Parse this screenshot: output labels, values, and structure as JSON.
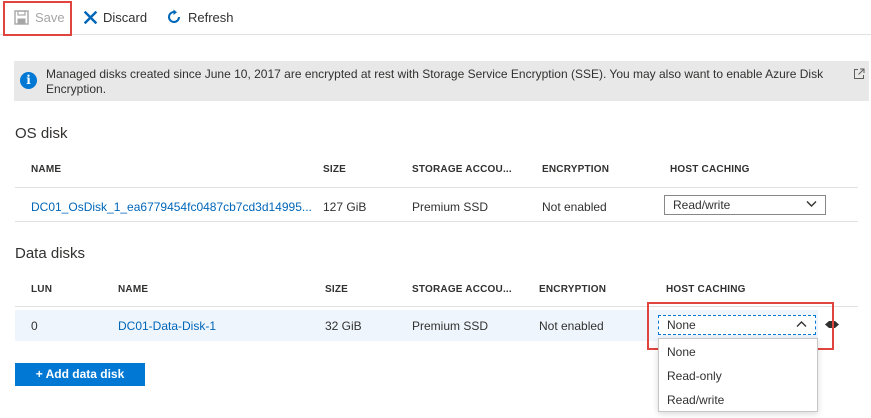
{
  "toolbar": {
    "save_label": "Save",
    "discard_label": "Discard",
    "refresh_label": "Refresh"
  },
  "banner": {
    "text": "Managed disks created since June 10, 2017 are encrypted at rest with Storage Service Encryption (SSE). You may also want to enable Azure Disk Encryption.",
    "info_glyph": "i"
  },
  "os_disk": {
    "title": "OS disk",
    "columns": [
      "NAME",
      "SIZE",
      "STORAGE ACCOU...",
      "ENCRYPTION",
      "HOST CACHING"
    ],
    "row": {
      "name": "DC01_OsDisk_1_ea6779454fc0487cb7cd3d14995...",
      "size": "127 GiB",
      "storage": "Premium SSD",
      "encryption": "Not enabled",
      "host_caching": "Read/write"
    }
  },
  "data_disks": {
    "title": "Data disks",
    "columns": [
      "LUN",
      "NAME",
      "SIZE",
      "STORAGE ACCOU...",
      "ENCRYPTION",
      "HOST CACHING"
    ],
    "row": {
      "lun": "0",
      "name": "DC01-Data-Disk-1",
      "size": "32 GiB",
      "storage": "Premium SSD",
      "encryption": "Not enabled",
      "host_caching": "None"
    },
    "dropdown_options": [
      "None",
      "Read-only",
      "Read/write"
    ]
  },
  "add_button_label": "+ Add data disk",
  "colors": {
    "accent": "#0078d4",
    "link": "#0066b8",
    "highlight": "#e0443e",
    "banner_bg": "#e8e8e8"
  },
  "icons": [
    "save-icon",
    "discard-icon",
    "refresh-icon",
    "info-icon",
    "external-link-icon",
    "chevron-down-icon",
    "chevron-up-icon",
    "drag-handle-icon"
  ]
}
